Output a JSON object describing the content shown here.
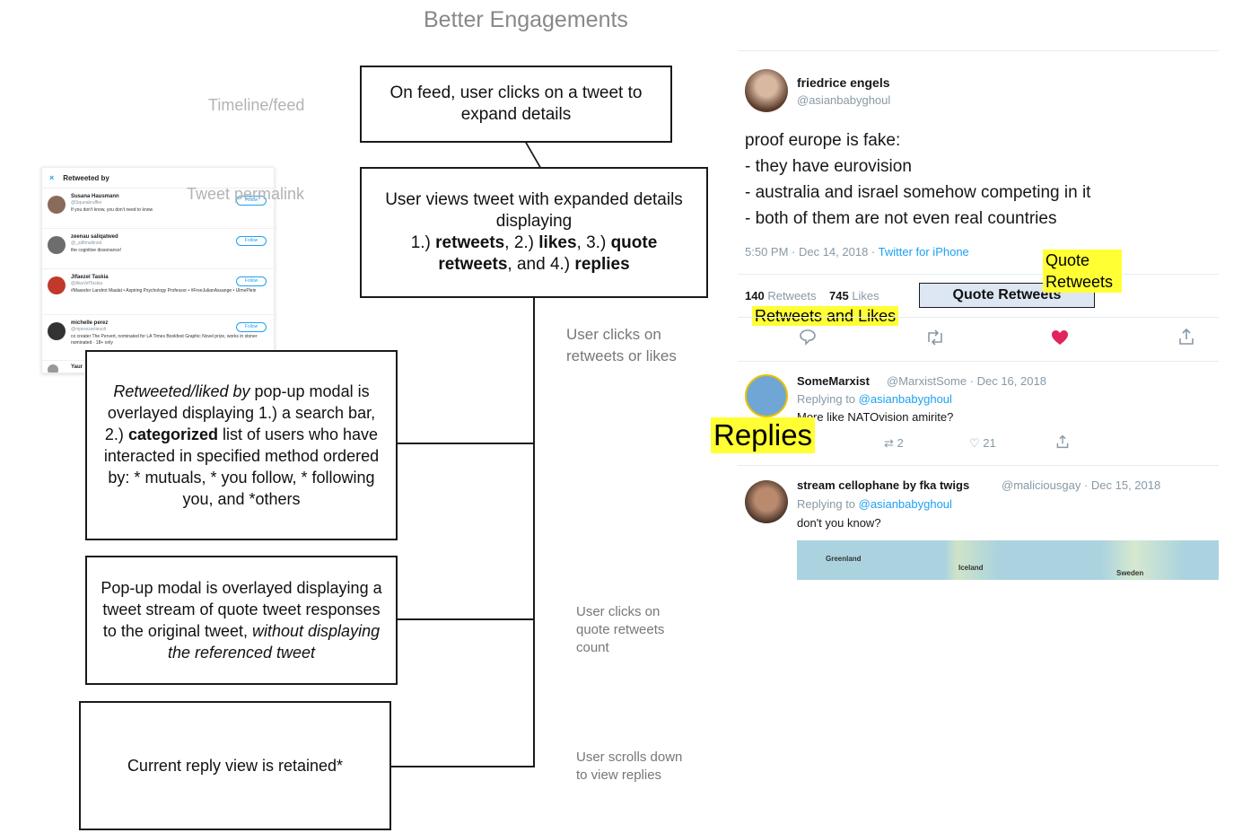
{
  "title": "Better Engagements",
  "side_labels": {
    "timeline": "Timeline/feed",
    "permalink": "Tweet permalink"
  },
  "boxes": {
    "b1": {
      "text": "On feed, user clicks on a tweet to expand details"
    },
    "b2": {
      "line1": "User views tweet with expanded details displaying",
      "p1": "1.) ",
      "w1": "retweets",
      "p2": ", 2.) ",
      "w2": "likes",
      "p3": ", 3.) ",
      "w3": "quote retweets",
      "p4": ", and 4.) ",
      "w4": "replies"
    },
    "b3": {
      "i1": "Retweeted/liked by",
      "t1": " pop-up modal is overlayed displaying 1.) a search bar, 2.) ",
      "bold1": "categorized",
      "t2": " list of users who have interacted in specified method ordered by: * mutuals, * you follow, * following you, and *others"
    },
    "b4": {
      "t1": "Pop-up modal is overlayed displaying a tweet stream of quote tweet responses to the original tweet, ",
      "i1": "without displaying the referenced tweet"
    },
    "b5": {
      "text": "Current reply view is retained*"
    }
  },
  "notes": {
    "n1": "User clicks on retweets or likes",
    "n2": "User clicks on quote retweets count",
    "n3": "User scrolls down to view replies"
  },
  "modal": {
    "title": "Retweeted by",
    "close": "×",
    "rows": [
      {
        "name": "Susana Hausmann",
        "handle": "@Squeakruffler",
        "bio": "If you don't know, you don't need to know",
        "btn": "Follow"
      },
      {
        "name": "zeenau saliqatwed",
        "handle": "@_aliftmatlirzid",
        "bio": "the cognitive dissonance!",
        "btn": "Follow"
      },
      {
        "name": "Jlfaezel Taskia",
        "handle": "@AkaVefTaskia",
        "bio": "#Masedor Landrot Maalat • Aspiring Psychology Professor • #FreeJulianAssange • UlmePlein",
        "btn": "Follow"
      },
      {
        "name": "michelle perez",
        "handle": "@mperezartiesoll",
        "bio": "co creater The Pervert, nominated for LA Times Bookfest Graphic Novel prize, works in stoner nominated · 18+ only",
        "btn": "Follow"
      },
      {
        "name": "Yaur",
        "handle": "",
        "bio": "",
        "btn": ""
      }
    ]
  },
  "tweet": {
    "name": "friedrice engels",
    "handle": "@asianbabyghoul",
    "lines": [
      "proof europe is fake:",
      "- they have eurovision",
      "- australia and israel somehow competing in it",
      "- both of them are not even real countries"
    ],
    "time": "5:50 PM · Dec 14, 2018 · ",
    "source": "Twitter for iPhone",
    "retweets_count": "140",
    "retweets_label": "Retweets",
    "likes_count": "745",
    "likes_label": "Likes",
    "quote_box": "Quote Retweets"
  },
  "highlights": {
    "quote": "Quote Retweets",
    "rtlikes": "Retweets and Likes",
    "replies": "Replies"
  },
  "replies": [
    {
      "name": "SomeMarxist",
      "handle": "@MarxistSome · Dec 16, 2018",
      "replying": "Replying to ",
      "to": "@asianbabyghoul",
      "text": "More like NATOvision amirite?",
      "rts": "2",
      "likes": "21"
    },
    {
      "name": "stream cellophane by fka twigs",
      "handle": "@maliciousgay · Dec 15, 2018",
      "replying": "Replying to ",
      "to": "@asianbabyghoul",
      "text": "don't you know?",
      "map_labels": [
        "Greenland",
        "Iceland",
        "Sweden"
      ]
    }
  ],
  "colors": {
    "highlight": "#ffff33",
    "twitter_blue": "#1da1f2",
    "like_red": "#e0245e",
    "quote_box_fill": "#dde6f3"
  }
}
